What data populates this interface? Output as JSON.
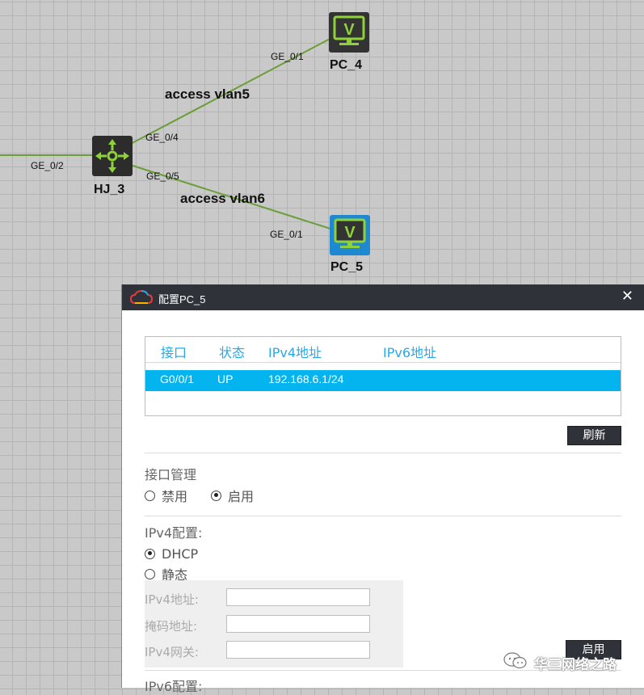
{
  "topology": {
    "devices": [
      {
        "id": "pc4",
        "name": "PC_4",
        "kind": "pc",
        "color": "#38a0d8"
      },
      {
        "id": "hj3",
        "name": "HJ_3",
        "kind": "switch"
      },
      {
        "id": "pc5",
        "name": "PC_5",
        "kind": "pc",
        "color": "#1e88d0"
      }
    ],
    "ports": {
      "pc4_ge01": "GE_0/1",
      "hj3_ge04": "GE_0/4",
      "hj3_ge05": "GE_0/5",
      "hj3_ge02": "GE_0/2",
      "pc5_ge01": "GE_0/1"
    },
    "link_labels": {
      "upper": "access vlan5",
      "lower": "access vlan6"
    },
    "link_color": "#6a9e38"
  },
  "dialog": {
    "title": "配置PC_5",
    "close_icon": "close-icon",
    "table": {
      "headers": [
        "接口",
        "状态",
        "IPv4地址",
        "IPv6地址"
      ],
      "rows": [
        {
          "interface": "G0/0/1",
          "status": "UP",
          "ipv4": "192.168.6.1/24",
          "ipv6": ""
        }
      ]
    },
    "refresh_label": "刷新",
    "interface_mgmt": {
      "label": "接口管理",
      "disable_label": "禁用",
      "enable_label": "启用",
      "selected": "enable"
    },
    "ipv4_config": {
      "label": "IPv4配置:",
      "dhcp_label": "DHCP",
      "static_label": "静态",
      "selected": "dhcp",
      "address_label": "IPv4地址:",
      "mask_label": "掩码地址:",
      "gateway_label": "IPv4网关:",
      "address_value": "",
      "mask_value": "",
      "gateway_value": ""
    },
    "apply_label": "启用",
    "ipv6_config_label": "IPv6配置:"
  },
  "watermark": {
    "text": "华三网络之路",
    "icon": "wechat-icon"
  },
  "colors": {
    "accent": "#03b4ef",
    "header_text": "#2aa7e6",
    "titlebar": "#2f3239"
  }
}
